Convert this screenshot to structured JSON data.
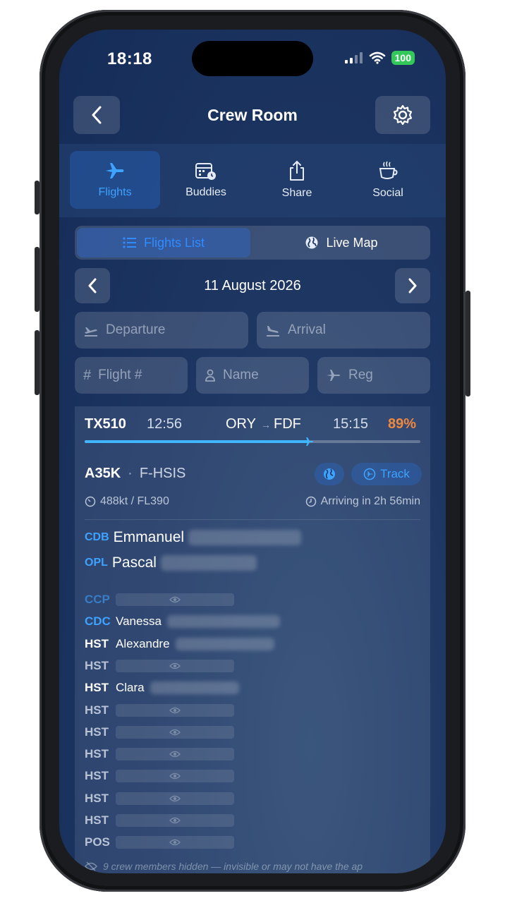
{
  "status_bar": {
    "time": "18:18",
    "battery": "100"
  },
  "header": {
    "title": "Crew Room"
  },
  "tabs": [
    {
      "label": "Flights",
      "icon": "airplane-icon",
      "active": true
    },
    {
      "label": "Buddies",
      "icon": "calendar-clock-icon",
      "active": false
    },
    {
      "label": "Share",
      "icon": "share-icon",
      "active": false
    },
    {
      "label": "Social",
      "icon": "coffee-cup-icon",
      "active": false
    }
  ],
  "segmented": {
    "list_label": "Flights List",
    "map_label": "Live Map"
  },
  "date": {
    "label": "11 August 2026"
  },
  "filters": {
    "departure": "Departure",
    "arrival": "Arrival",
    "flight": "Flight #",
    "name": "Name",
    "reg": "Reg"
  },
  "flight": {
    "number": "TX510",
    "dep_time": "12:56",
    "origin": "ORY",
    "arrow": "→",
    "destination": "FDF",
    "arr_time": "15:15",
    "progress_label": "89%",
    "progress_fraction": 0.67,
    "aircraft": "A35K",
    "separator": "·",
    "registration": "F-HSIS",
    "track_label": "Track",
    "speed_alt": "488kt / FL390",
    "arriving": "Arriving in 2h 56min",
    "accent_color": "#3ea2ff",
    "progress_color": "#f0883e"
  },
  "crew_main": [
    {
      "role": "CDB",
      "name": "Emmanuel"
    },
    {
      "role": "OPL",
      "name": "Pascal"
    }
  ],
  "crew": [
    {
      "role": "CCP",
      "name": "",
      "hidden": true
    },
    {
      "role": "CDC",
      "name": "Vanessa",
      "hidden": false
    },
    {
      "role": "HST",
      "name": "Alexandre",
      "hidden": false
    },
    {
      "role": "HST",
      "name": "",
      "hidden": true
    },
    {
      "role": "HST",
      "name": "Clara",
      "hidden": false
    },
    {
      "role": "HST",
      "name": "",
      "hidden": true
    },
    {
      "role": "HST",
      "name": "",
      "hidden": true
    },
    {
      "role": "HST",
      "name": "",
      "hidden": true
    },
    {
      "role": "HST",
      "name": "",
      "hidden": true
    },
    {
      "role": "HST",
      "name": "",
      "hidden": true
    },
    {
      "role": "HST",
      "name": "",
      "hidden": true
    },
    {
      "role": "POS",
      "name": "",
      "hidden": true
    }
  ],
  "footnote": "9 crew members hidden — invisible or may not have the ap"
}
